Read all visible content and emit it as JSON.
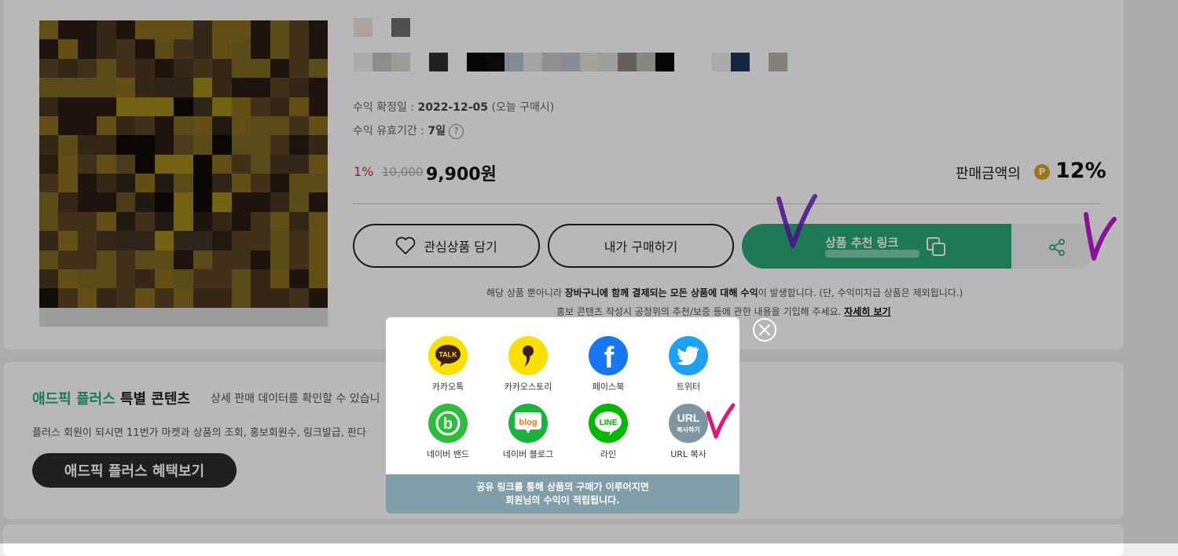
{
  "product": {
    "confirm_label": "수익 확정일 : ",
    "confirm_date": "2022-12-05",
    "confirm_note": " (오늘 구매시)",
    "valid_label": "수익 유효기간 : ",
    "valid_value": "7일",
    "help_glyph": "?",
    "discount_rate": "1%",
    "original_price": "10,000",
    "sale_price": "9,900원",
    "commission_label": "판매금액의",
    "coin_glyph": "P",
    "commission_rate": "12%"
  },
  "actions": {
    "wish_label": "관심상품 담기",
    "buy_label": "내가 구매하기",
    "link_label": "상품 추천 링크"
  },
  "notes": {
    "line1_pre": "해당 상품 뿐아니라 ",
    "line1_bold": "장바구니에 함께 결제되는 모든 상품에 대해 수익",
    "line1_post": "이 발생합니다. (단, 수익미지급 상품은 제외됩니다.)",
    "line2_pre": "홍보 콘텐츠 작성시 공정위의 추천/보증 등에 관한 내용을 기입해 주세요. ",
    "line2_link": "자세히 보기"
  },
  "plus": {
    "title_green": "애드픽 플러스",
    "title_rest": " 특별 콘텐츠",
    "desc": "상세 판매 데이터를 확인할 수 있습니",
    "text": "플러스 회원이 되시면 11번가 마켓과 상품의 조회, 홍보회원수, 링크발급, 판다",
    "button": "애드픽 플러스 혜택보기"
  },
  "share_modal": {
    "items": [
      {
        "label": "카카오톡",
        "icon": "kakaotalk-icon",
        "icon_text": "TALK",
        "color": "#f9e000"
      },
      {
        "label": "카카오스토리",
        "icon": "kakaostory-icon",
        "icon_text": "",
        "color": "#f9e000"
      },
      {
        "label": "페이스북",
        "icon": "facebook-icon",
        "icon_text": "f",
        "color": "#1877f2"
      },
      {
        "label": "트위터",
        "icon": "twitter-icon",
        "icon_text": "",
        "color": "#1da1f2"
      },
      {
        "label": "네이버 밴드",
        "icon": "naver-band-icon",
        "icon_text": "b",
        "color": "#2dbc3c"
      },
      {
        "label": "네이버 블로그",
        "icon": "naver-blog-icon",
        "icon_text": "blog",
        "color": "#19b43c"
      },
      {
        "label": "라인",
        "icon": "line-icon",
        "icon_text": "LINE",
        "color": "#00b900"
      },
      {
        "label": "URL 복사",
        "icon": "url-copy-icon",
        "icon_text": "URL",
        "icon_subtext": "복사하기",
        "color": "#7d96a2"
      }
    ],
    "footer_line1": "공유 링크를 통해 상품의 구매가 이루어지면",
    "footer_line2": "회원님의 수익이 적립됩니다."
  }
}
